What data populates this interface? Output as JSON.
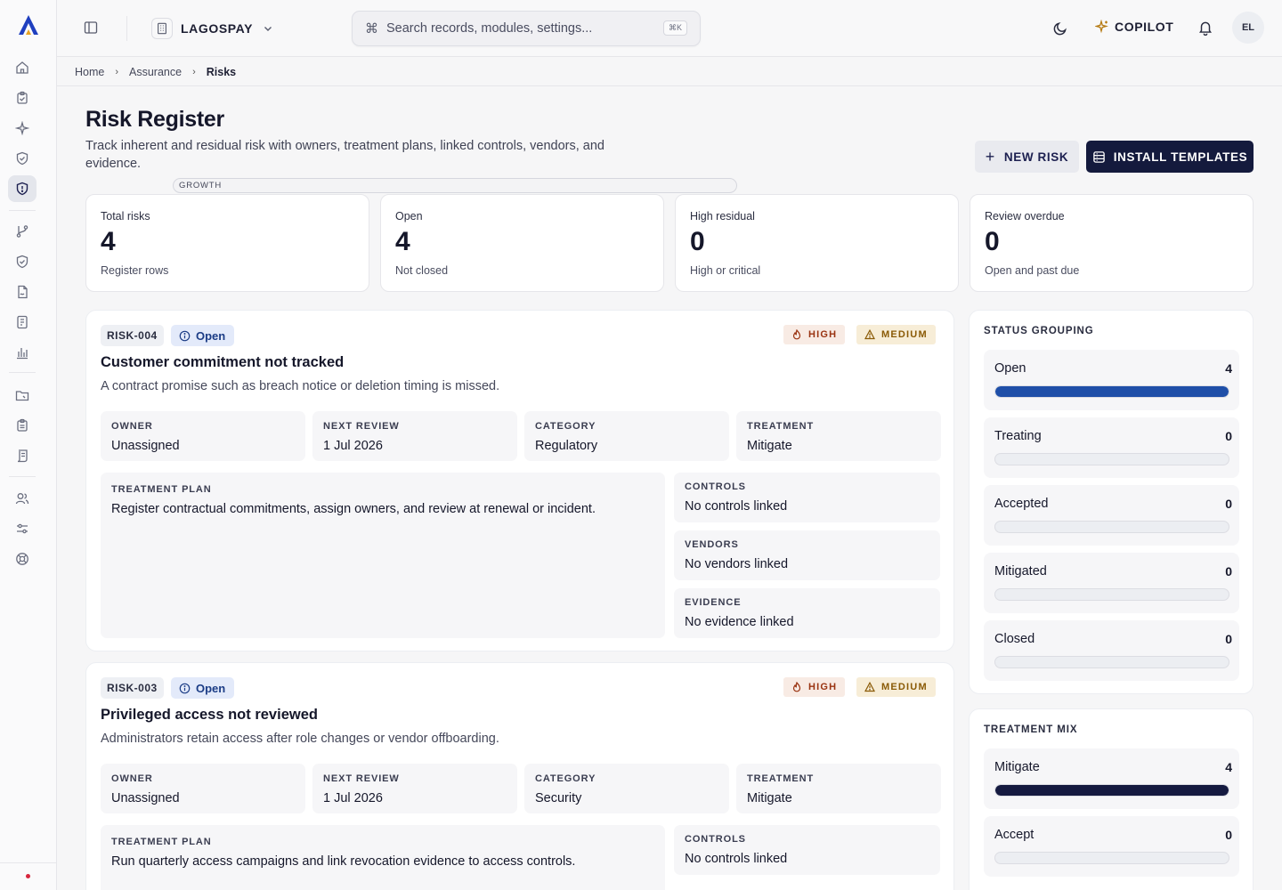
{
  "app": {
    "org_name": "LAGOSPAY",
    "plan_badge": "GROWTH",
    "search_placeholder": "Search records, modules, settings...",
    "search_shortcut": "⌘K",
    "copilot_label": "COPILOT",
    "avatar_initials": "EL"
  },
  "breadcrumb": {
    "home": "Home",
    "section": "Assurance",
    "current": "Risks"
  },
  "page": {
    "title": "Risk Register",
    "subtitle": "Track inherent and residual risk with owners, treatment plans, linked controls, vendors, and evidence.",
    "new_risk_label": "NEW RISK",
    "install_templates_label": "INSTALL TEMPLATES"
  },
  "kpis": [
    {
      "label": "Total risks",
      "value": "4",
      "sub": "Register rows"
    },
    {
      "label": "Open",
      "value": "4",
      "sub": "Not closed"
    },
    {
      "label": "High residual",
      "value": "0",
      "sub": "High or critical"
    },
    {
      "label": "Review overdue",
      "value": "0",
      "sub": "Open and past due"
    }
  ],
  "risks": [
    {
      "id": "RISK-004",
      "status": "Open",
      "inherent": "HIGH",
      "residual": "MEDIUM",
      "title": "Customer commitment not tracked",
      "description": "A contract promise such as breach notice or deletion timing is missed.",
      "fields": {
        "owner_label": "OWNER",
        "owner": "Unassigned",
        "review_label": "NEXT REVIEW",
        "review": "1 Jul 2026",
        "category_label": "CATEGORY",
        "category": "Regulatory",
        "treatment_label": "TREATMENT",
        "treatment": "Mitigate"
      },
      "plan_label": "TREATMENT PLAN",
      "plan": "Register contractual commitments, assign owners, and review at renewal or incident.",
      "controls_label": "CONTROLS",
      "controls": "No controls linked",
      "vendors_label": "VENDORS",
      "vendors": "No vendors linked",
      "evidence_label": "EVIDENCE",
      "evidence": "No evidence linked"
    },
    {
      "id": "RISK-003",
      "status": "Open",
      "inherent": "HIGH",
      "residual": "MEDIUM",
      "title": "Privileged access not reviewed",
      "description": "Administrators retain access after role changes or vendor offboarding.",
      "fields": {
        "owner_label": "OWNER",
        "owner": "Unassigned",
        "review_label": "NEXT REVIEW",
        "review": "1 Jul 2026",
        "category_label": "CATEGORY",
        "category": "Security",
        "treatment_label": "TREATMENT",
        "treatment": "Mitigate"
      },
      "plan_label": "TREATMENT PLAN",
      "plan": "Run quarterly access campaigns and link revocation evidence to access controls.",
      "controls_label": "CONTROLS",
      "controls": "No controls linked"
    }
  ],
  "status_grouping": {
    "title": "STATUS GROUPING",
    "accent": "#1f4fa8",
    "total": 4,
    "rows": [
      {
        "label": "Open",
        "count": "4",
        "fraction": 1.0
      },
      {
        "label": "Treating",
        "count": "0",
        "fraction": 0
      },
      {
        "label": "Accepted",
        "count": "0",
        "fraction": 0
      },
      {
        "label": "Mitigated",
        "count": "0",
        "fraction": 0
      },
      {
        "label": "Closed",
        "count": "0",
        "fraction": 0
      }
    ]
  },
  "treatment_mix": {
    "title": "TREATMENT MIX",
    "accent": "#151a40",
    "rows": [
      {
        "label": "Mitigate",
        "count": "4",
        "fraction": 1.0
      },
      {
        "label": "Accept",
        "count": "0",
        "fraction": 0
      }
    ]
  },
  "colors": {
    "primary": "#141a3d",
    "status_blue": "#1c3d86",
    "high": "#9a3412",
    "medium": "#8a5a06"
  }
}
